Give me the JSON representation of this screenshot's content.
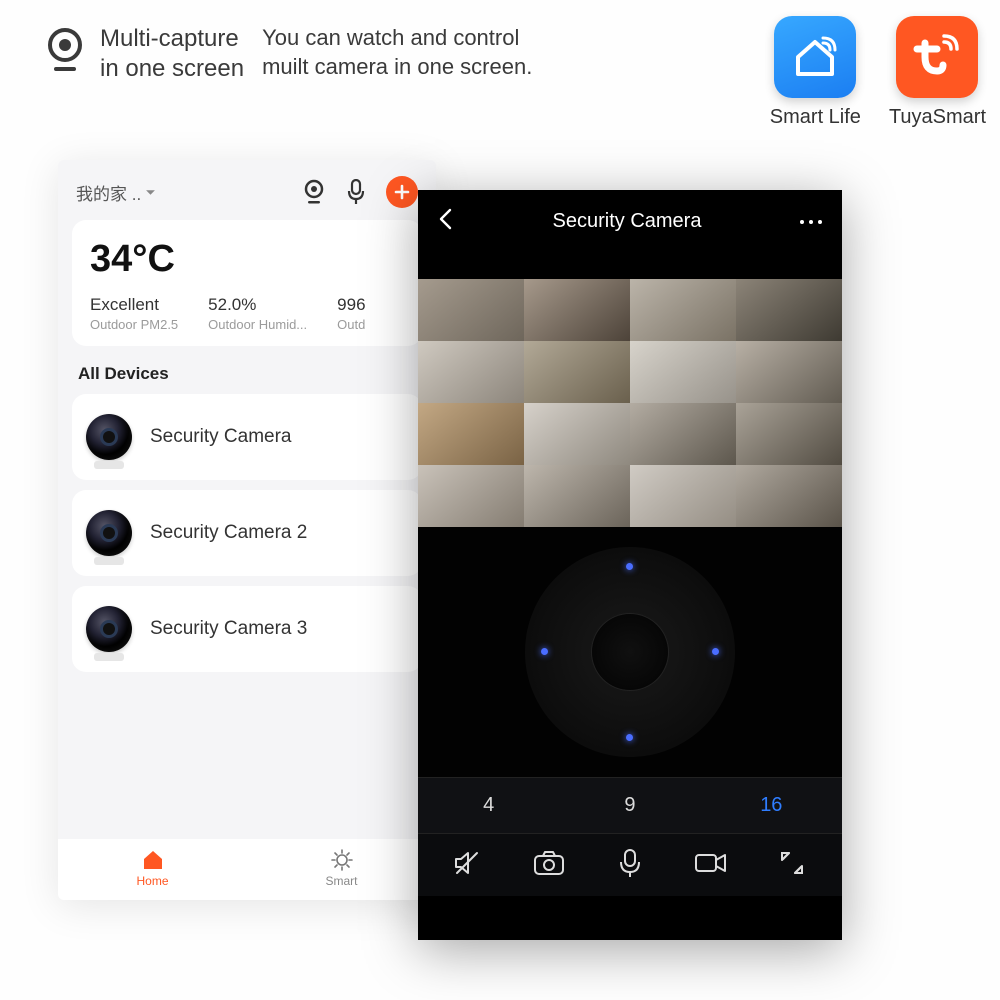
{
  "header": {
    "title_line1": "Multi-capture",
    "title_line2": "in one screen",
    "desc_line1": "You can watch and control",
    "desc_line2": "muilt camera in one screen."
  },
  "apps": {
    "smartlife": "Smart Life",
    "tuya": "TuyaSmart"
  },
  "phone1": {
    "home_selector": "我的家 ..",
    "temp": "34°C",
    "metrics": [
      {
        "val": "Excellent",
        "lbl": "Outdoor PM2.5"
      },
      {
        "val": "52.0%",
        "lbl": "Outdoor Humid..."
      },
      {
        "val": "996",
        "lbl": "Outd"
      }
    ],
    "section": "All Devices",
    "devices": [
      {
        "name": "Security Camera"
      },
      {
        "name": "Security Camera 2"
      },
      {
        "name": "Security Camera 3"
      }
    ],
    "nav": {
      "home": "Home",
      "smart": "Smart"
    }
  },
  "phone2": {
    "title": "Security Camera",
    "nums": {
      "n4": "4",
      "n9": "9",
      "n16": "16"
    }
  }
}
